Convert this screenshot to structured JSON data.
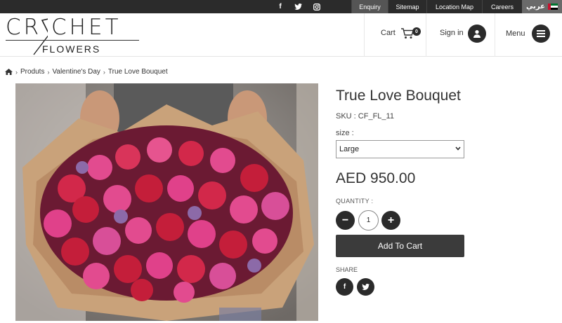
{
  "topbar": {
    "social": [
      {
        "icon": "facebook-icon",
        "glyph": "f"
      },
      {
        "icon": "twitter-icon",
        "glyph": "•"
      },
      {
        "icon": "instagram-icon",
        "glyph": "▣"
      }
    ],
    "nav": [
      "Enquiry",
      "Sitemap",
      "Location Map",
      "Careers"
    ],
    "active_nav": "Enquiry",
    "language": "عربي"
  },
  "header": {
    "logo": {
      "top": "CR   CHET",
      "bottom": "FLOWERS"
    },
    "cart_label": "Cart",
    "cart_count": "0",
    "signin_label": "Sign in",
    "menu_label": "Menu"
  },
  "breadcrumb": {
    "items": [
      "Produts",
      "Valentine's Day",
      "True Love Bouquet"
    ]
  },
  "product": {
    "title": "True Love Bouquet",
    "sku": "SKU : CF_FL_11",
    "size_label": "size :",
    "size_selected": "Large",
    "price": "AED 950.00",
    "quantity_label": "QUANTITY :",
    "quantity": "1",
    "minus": "−",
    "plus": "+",
    "add_to_cart": "Add To Cart",
    "share_label": "SHARE",
    "share_facebook": "f",
    "share_twitter": "t"
  },
  "colors": {
    "dark": "#2b2b2b",
    "topbar_active": "#555555",
    "button": "#3b3b3b"
  }
}
